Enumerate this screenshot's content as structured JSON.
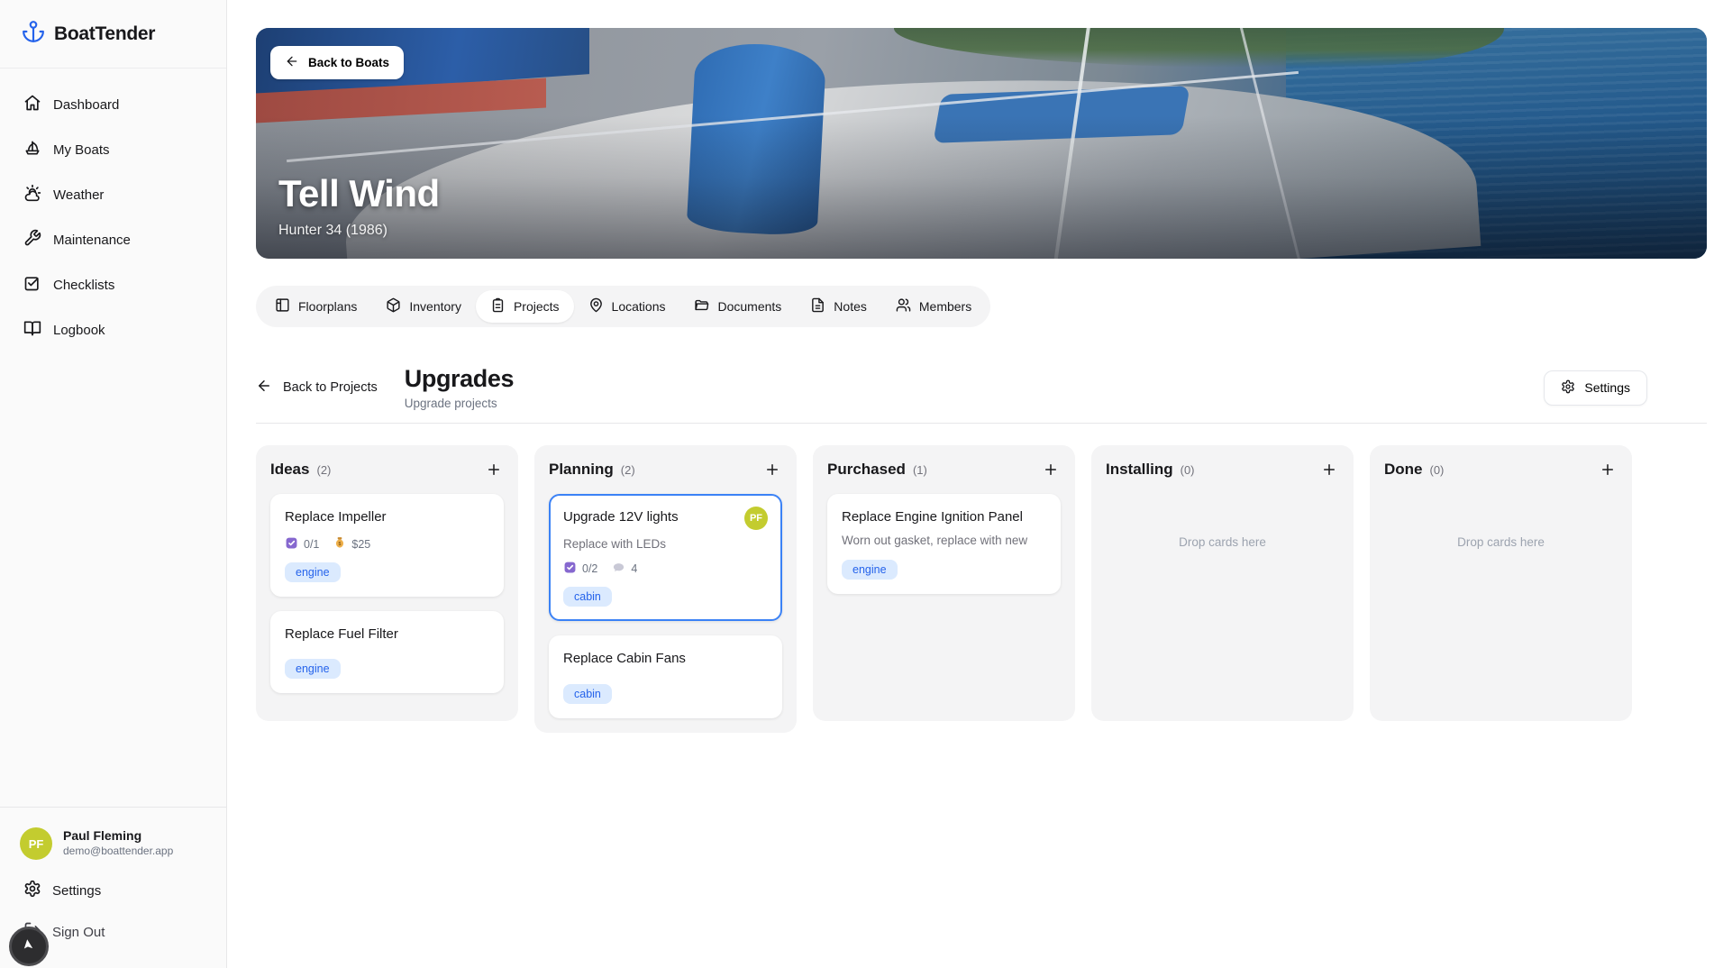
{
  "app": {
    "name": "BoatTender"
  },
  "colors": {
    "accent_blue": "#2563eb",
    "selected_border": "#3b82f6",
    "avatar_bg": "#c3cc2f",
    "tag_bg": "#dbeafe",
    "tag_text": "#2563eb",
    "checkbox_purple": "#8668cf"
  },
  "sidebar": {
    "nav": [
      {
        "label": "Dashboard"
      },
      {
        "label": "My Boats"
      },
      {
        "label": "Weather"
      },
      {
        "label": "Maintenance"
      },
      {
        "label": "Checklists"
      },
      {
        "label": "Logbook"
      }
    ],
    "user": {
      "initials": "PF",
      "name": "Paul Fleming",
      "email": "demo@boattender.app"
    },
    "settings_label": "Settings",
    "signout_label": "Sign Out"
  },
  "hero": {
    "back_label": "Back to Boats",
    "title": "Tell Wind",
    "subtitle": "Hunter 34 (1986)"
  },
  "tabs": [
    {
      "label": "Floorplans"
    },
    {
      "label": "Inventory"
    },
    {
      "label": "Projects"
    },
    {
      "label": "Locations"
    },
    {
      "label": "Documents"
    },
    {
      "label": "Notes"
    },
    {
      "label": "Members"
    }
  ],
  "board_header": {
    "back_label": "Back to Projects",
    "title": "Upgrades",
    "subtitle": "Upgrade projects",
    "settings_label": "Settings"
  },
  "board": {
    "drop_placeholder": "Drop cards here",
    "columns": [
      {
        "title": "Ideas",
        "count": "(2)",
        "cards": [
          {
            "title": "Replace Impeller",
            "checklist": "0/1",
            "cost": "$25",
            "tags": [
              "engine"
            ]
          },
          {
            "title": "Replace Fuel Filter",
            "tags": [
              "engine"
            ]
          }
        ]
      },
      {
        "title": "Planning",
        "count": "(2)",
        "cards": [
          {
            "title": "Upgrade 12V lights",
            "description": "Replace with LEDs",
            "checklist": "0/2",
            "comments": "4",
            "avatar": "PF",
            "tags": [
              "cabin"
            ]
          },
          {
            "title": "Replace Cabin Fans",
            "tags": [
              "cabin"
            ]
          }
        ]
      },
      {
        "title": "Purchased",
        "count": "(1)",
        "cards": [
          {
            "title": "Replace Engine Ignition Panel",
            "description": "Worn out gasket, replace with new",
            "tags": [
              "engine"
            ]
          }
        ]
      },
      {
        "title": "Installing",
        "count": "(0)",
        "cards": []
      },
      {
        "title": "Done",
        "count": "(0)",
        "cards": []
      }
    ]
  }
}
